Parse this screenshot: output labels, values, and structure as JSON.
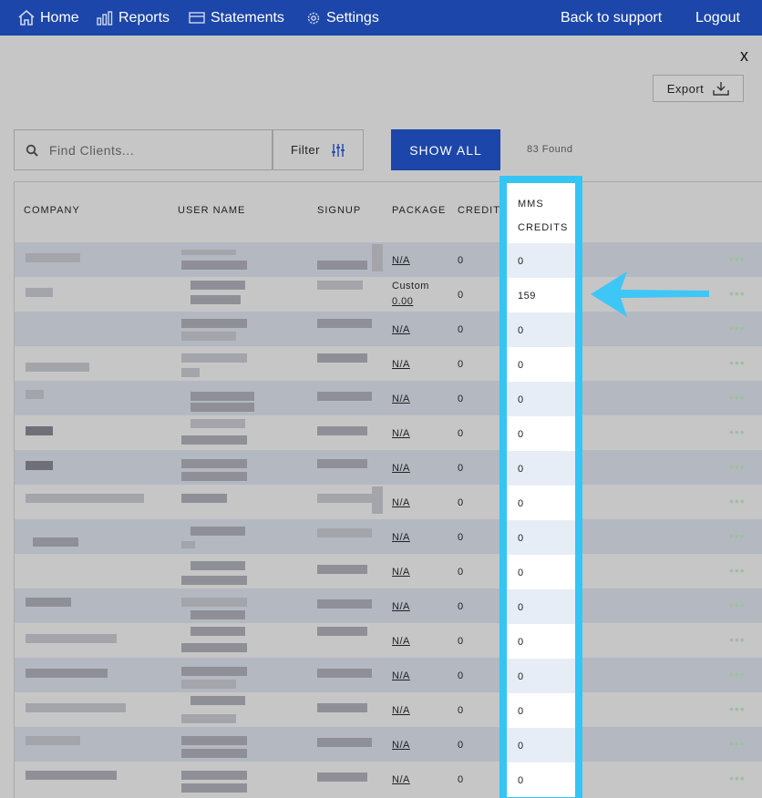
{
  "nav": {
    "home": "Home",
    "reports": "Reports",
    "statements": "Statements",
    "settings": "Settings",
    "support": "Back to support",
    "logout": "Logout"
  },
  "dialog": {
    "close_label": "x",
    "export_label": "Export",
    "search_placeholder": "Find Clients...",
    "filter_label": "Filter",
    "show_all_label": "SHOW ALL",
    "found_text": "83 Found"
  },
  "table": {
    "headers": {
      "company": "COMPANY",
      "user_name": "USER NAME",
      "signup": "SIGNUP",
      "package": "PACKAGE",
      "credits": "CREDITS",
      "mms_credits_line1": "MMS",
      "mms_credits_line2": "CREDITS"
    },
    "row_menu_label": "•••",
    "rows": [
      {
        "package": "N/A",
        "credits": "0",
        "mms_credits": "0"
      },
      {
        "package_label": "Custom",
        "package": "0.00",
        "credits": "0",
        "mms_credits": "159"
      },
      {
        "package": "N/A",
        "credits": "0",
        "mms_credits": "0"
      },
      {
        "package": "N/A",
        "credits": "0",
        "mms_credits": "0"
      },
      {
        "package": "N/A",
        "credits": "0",
        "mms_credits": "0"
      },
      {
        "package": "N/A",
        "credits": "0",
        "mms_credits": "0"
      },
      {
        "package": "N/A",
        "credits": "0",
        "mms_credits": "0"
      },
      {
        "package": "N/A",
        "credits": "0",
        "mms_credits": "0"
      },
      {
        "package": "N/A",
        "credits": "0",
        "mms_credits": "0"
      },
      {
        "package": "N/A",
        "credits": "0",
        "mms_credits": "0"
      },
      {
        "package": "N/A",
        "credits": "0",
        "mms_credits": "0"
      },
      {
        "package": "N/A",
        "credits": "0",
        "mms_credits": "0"
      },
      {
        "package": "N/A",
        "credits": "0",
        "mms_credits": "0"
      },
      {
        "package": "N/A",
        "credits": "0",
        "mms_credits": "0"
      },
      {
        "package": "N/A",
        "credits": "0",
        "mms_credits": "0"
      },
      {
        "package": "N/A",
        "credits": "0",
        "mms_credits": "0"
      }
    ]
  },
  "colors": {
    "nav_bg": "#1c46a9",
    "highlight": "#34c5f4",
    "arrow": "#3ec6f6"
  }
}
